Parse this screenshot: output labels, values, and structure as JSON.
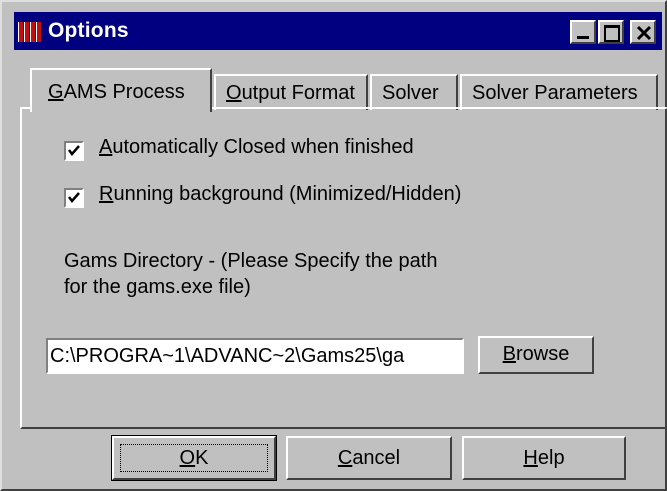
{
  "window": {
    "title": "Options",
    "app_icon": "gams-logo-icon"
  },
  "caption_buttons": [
    {
      "name": "minimize",
      "icon": "minimize-icon"
    },
    {
      "name": "maximize",
      "icon": "maximize-icon"
    },
    {
      "name": "close",
      "icon": "close-icon"
    }
  ],
  "tabs": [
    {
      "key": "G",
      "rest": "AMS Process",
      "active": true
    },
    {
      "key": "O",
      "rest": "utput Format",
      "active": false
    },
    {
      "label": "Solver",
      "active": false
    },
    {
      "label": "Solver Parameters",
      "active": false
    }
  ],
  "options": {
    "auto_close": {
      "key": "A",
      "rest": "utomatically Closed when finished",
      "checked": true
    },
    "background": {
      "key": "R",
      "rest": "unning background (Minimized/Hidden)",
      "checked": true
    }
  },
  "directory": {
    "label": "Gams Directory - (Please Specify the path\nfor the gams.exe file)",
    "path_value": "C:\\PROGRA~1\\ADVANC~2\\Gams25\\ga"
  },
  "buttons": {
    "browse": {
      "key": "B",
      "rest": "rowse"
    },
    "ok": {
      "key": "O",
      "rest": "K"
    },
    "cancel": {
      "key": "C",
      "rest": "ancel"
    },
    "help": {
      "key": "H",
      "rest": "elp"
    }
  },
  "colors": {
    "titlebar": "#000080",
    "face": "#c0c0c0",
    "icon_red": "#c01010"
  }
}
